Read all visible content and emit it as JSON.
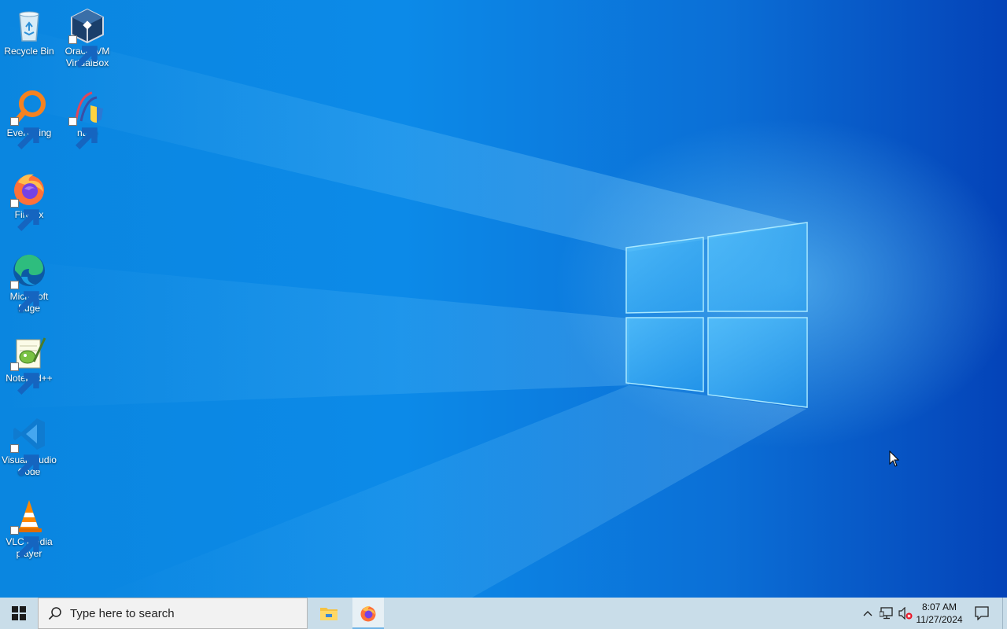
{
  "desktop": {
    "icons": [
      {
        "label": "Recycle Bin",
        "icon": "recycle-bin-icon"
      },
      {
        "label": "Oracle VM VirtualBox",
        "icon": "virtualbox-icon"
      },
      {
        "label": "Everything",
        "icon": "everything-search-icon"
      },
      {
        "label": "nLite",
        "icon": "nlite-icon"
      },
      {
        "label": "Firefox",
        "icon": "firefox-icon"
      },
      {
        "label": "Microsoft Edge",
        "icon": "edge-icon"
      },
      {
        "label": "Notepad++",
        "icon": "notepadpp-icon"
      },
      {
        "label": "Visual Studio Code",
        "icon": "vscode-icon"
      },
      {
        "label": "VLC media player",
        "icon": "vlc-icon"
      }
    ]
  },
  "taskbar": {
    "search_placeholder": "Type here to search",
    "pinned": [
      {
        "name": "File Explorer",
        "icon": "file-explorer-icon",
        "active": false
      },
      {
        "name": "Firefox",
        "icon": "firefox-icon",
        "active": true
      }
    ],
    "tray": {
      "time": "8:07 AM",
      "date": "11/27/2024",
      "icons": [
        "chevron-up-icon",
        "network-icon",
        "volume-muted-icon",
        "notification-icon"
      ]
    }
  },
  "colors": {
    "taskbar": "#c9dde9",
    "wallpaper_blue": "#0a86e0"
  }
}
